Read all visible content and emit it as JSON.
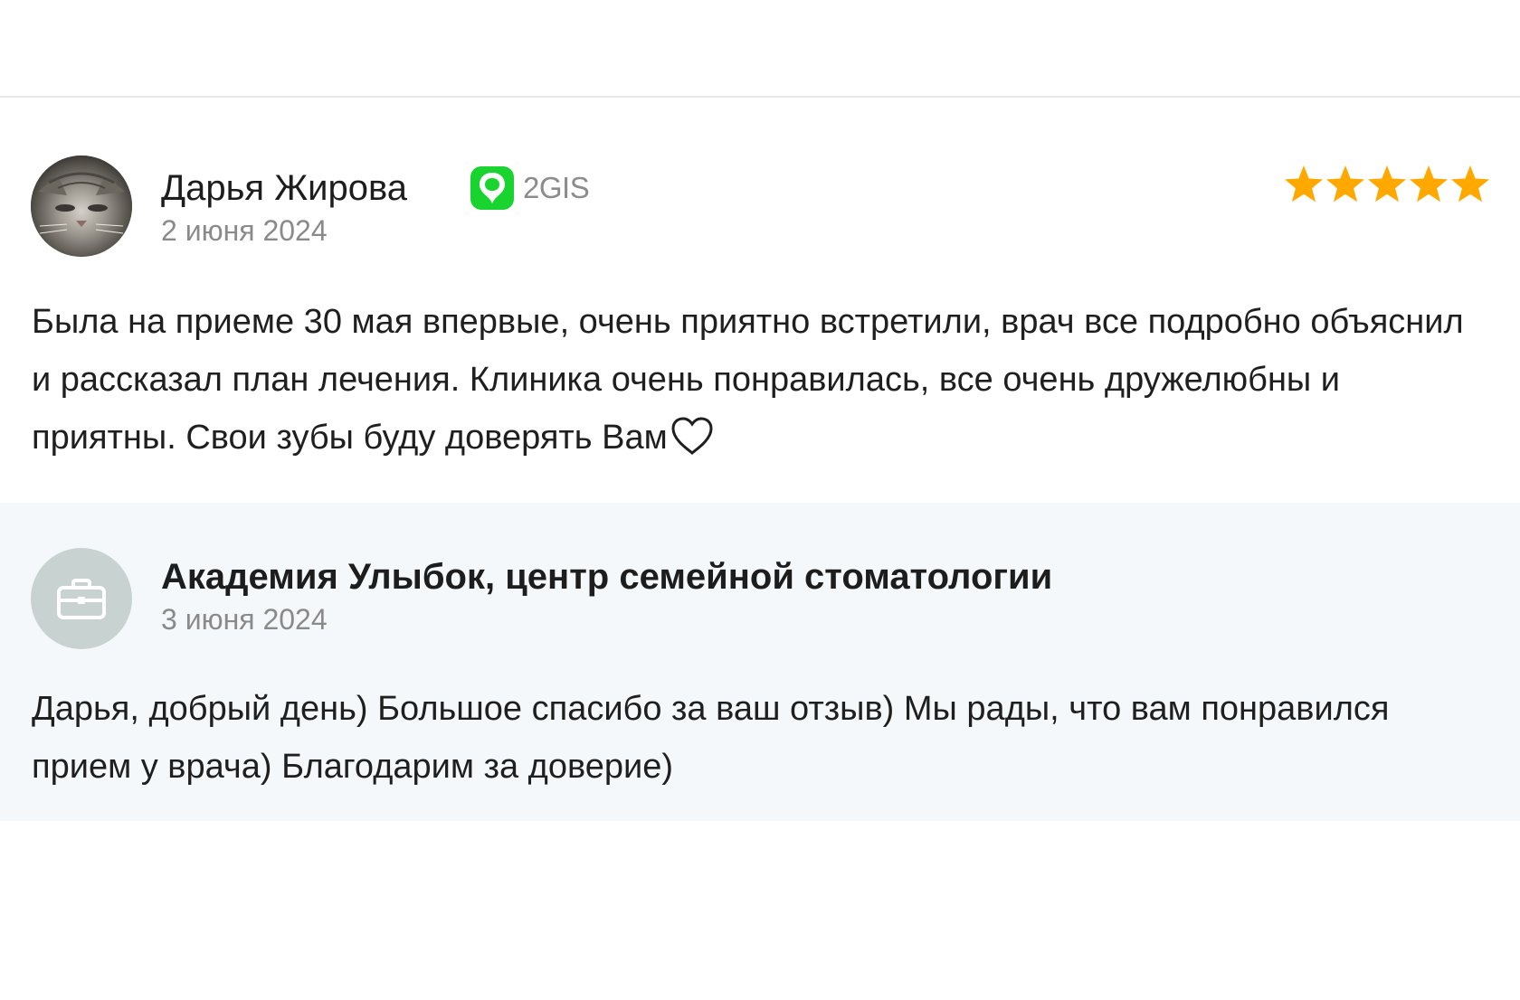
{
  "review": {
    "author_name": "Дарья Жирова",
    "source_label": "2GIS",
    "source_icon": "2gis-logo-icon",
    "source_color": "#19d32e",
    "date": "2 июня 2024",
    "rating": 5,
    "rating_max": 5,
    "star_color": "#ffa800",
    "text": "Была на приеме 30 мая впервые, очень приятно встретили, врач все подробно объяснил и рассказал план лечения. Клиника очень понравилась, все очень дружелюбны и приятны. Свои зубы буду доверять Вам",
    "trailing_icon": "heart-outline-icon"
  },
  "reply": {
    "org_name": "Академия Улыбок, центр семейной стоматологии",
    "org_icon": "briefcase-icon",
    "date": "3 июня 2024",
    "text": "Дарья, добрый день) Большое спасибо за ваш отзыв) Мы рады, что вам понравился прием у врача) Благодарим за доверие)",
    "background_color": "#f5f8fa"
  }
}
